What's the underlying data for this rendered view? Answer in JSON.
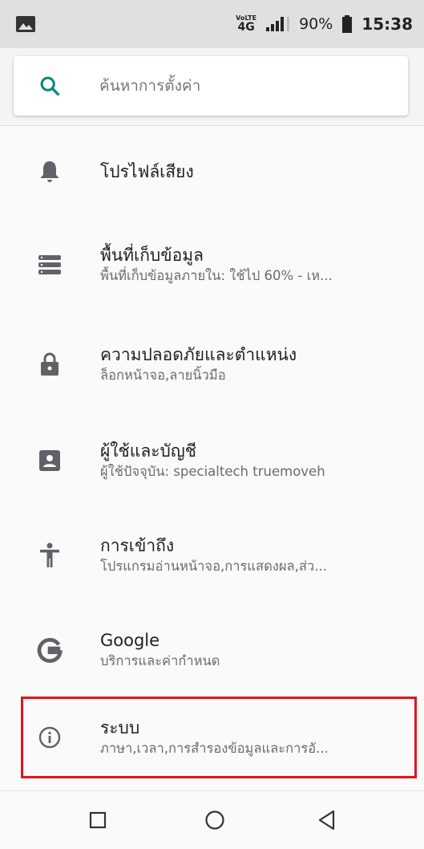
{
  "status_bar": {
    "volte_top": "VoLTE",
    "volte_bottom": "4G",
    "battery": "90%",
    "time": "15:38"
  },
  "search": {
    "placeholder": "ค้นหาการตั้งค่า"
  },
  "settings": [
    {
      "icon": "bell-icon",
      "title": "โปรไฟล์เสียง",
      "subtitle": ""
    },
    {
      "icon": "storage-icon",
      "title": "พื้นที่เก็บข้อมูล",
      "subtitle": "พื้นที่เก็บข้อมูลภายใน: ใช้ไป 60% - เห..."
    },
    {
      "icon": "lock-icon",
      "title": "ความปลอดภัยและตำแหน่ง",
      "subtitle": "ล็อกหน้าจอ,ลายนิ้วมือ"
    },
    {
      "icon": "account-icon",
      "title": "ผู้ใช้และบัญชี",
      "subtitle": "ผู้ใช้ปัจจุบัน: specialtech truemoveh"
    },
    {
      "icon": "accessibility-icon",
      "title": "การเข้าถึง",
      "subtitle": "โปรแกรมอ่านหน้าจอ,การแสดงผล,ส่ว..."
    },
    {
      "icon": "google-icon",
      "title": "Google",
      "subtitle": "บริการและค่ากำหนด"
    },
    {
      "icon": "info-icon",
      "title": "ระบบ",
      "subtitle": "ภาษา,เวลา,การสำรองข้อมูลและการอั..."
    }
  ],
  "colors": {
    "accent": "#00897b",
    "highlight": "#e0141e",
    "icon": "#5f6368"
  },
  "nav": {
    "recents": "square-icon",
    "home": "circle-icon",
    "back": "triangle-back-icon"
  }
}
